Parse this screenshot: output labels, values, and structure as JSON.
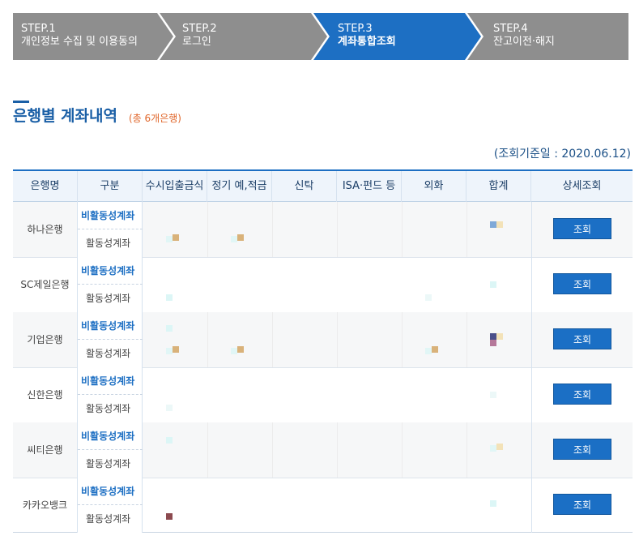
{
  "steps": [
    {
      "num": "STEP.1",
      "name": "개인정보 수집 및 이용동의"
    },
    {
      "num": "STEP.2",
      "name": "로그인"
    },
    {
      "num": "STEP.3",
      "name": "계좌통합조회"
    },
    {
      "num": "STEP.4",
      "name": "잔고이전·해지"
    }
  ],
  "active_step": 3,
  "title": "은행별 계좌내역",
  "subtitle": "(총 6개은행)",
  "base_date": "(조회기준일 : 2020.06.12)",
  "table": {
    "headers": [
      "은행명",
      "구분",
      "수시입출금식",
      "정기 예,적금",
      "신탁",
      "ISA·펀드 등",
      "외화",
      "합계",
      "상세조회"
    ],
    "banks": [
      {
        "name": "하나은행",
        "inactive": "비활동성계좌",
        "active": "활동성계좌",
        "button": "조회"
      },
      {
        "name": "SC제일은행",
        "inactive": "비활동성계좌",
        "active": "활동성계좌",
        "button": "조회"
      },
      {
        "name": "기업은행",
        "inactive": "비활동성계좌",
        "active": "활동성계좌",
        "button": "조회"
      },
      {
        "name": "신한은행",
        "inactive": "비활동성계좌",
        "active": "활동성계좌",
        "button": "조회"
      },
      {
        "name": "씨티은행",
        "inactive": "비활동성계좌",
        "active": "활동성계좌",
        "button": "조회"
      },
      {
        "name": "카카오뱅크",
        "inactive": "비활동성계좌",
        "active": "활동성계좌",
        "button": "조회"
      }
    ]
  },
  "colors": {
    "accent": "#1d6fc3",
    "step_inactive": "#8e8e8e",
    "subtitle": "#e0662a"
  }
}
